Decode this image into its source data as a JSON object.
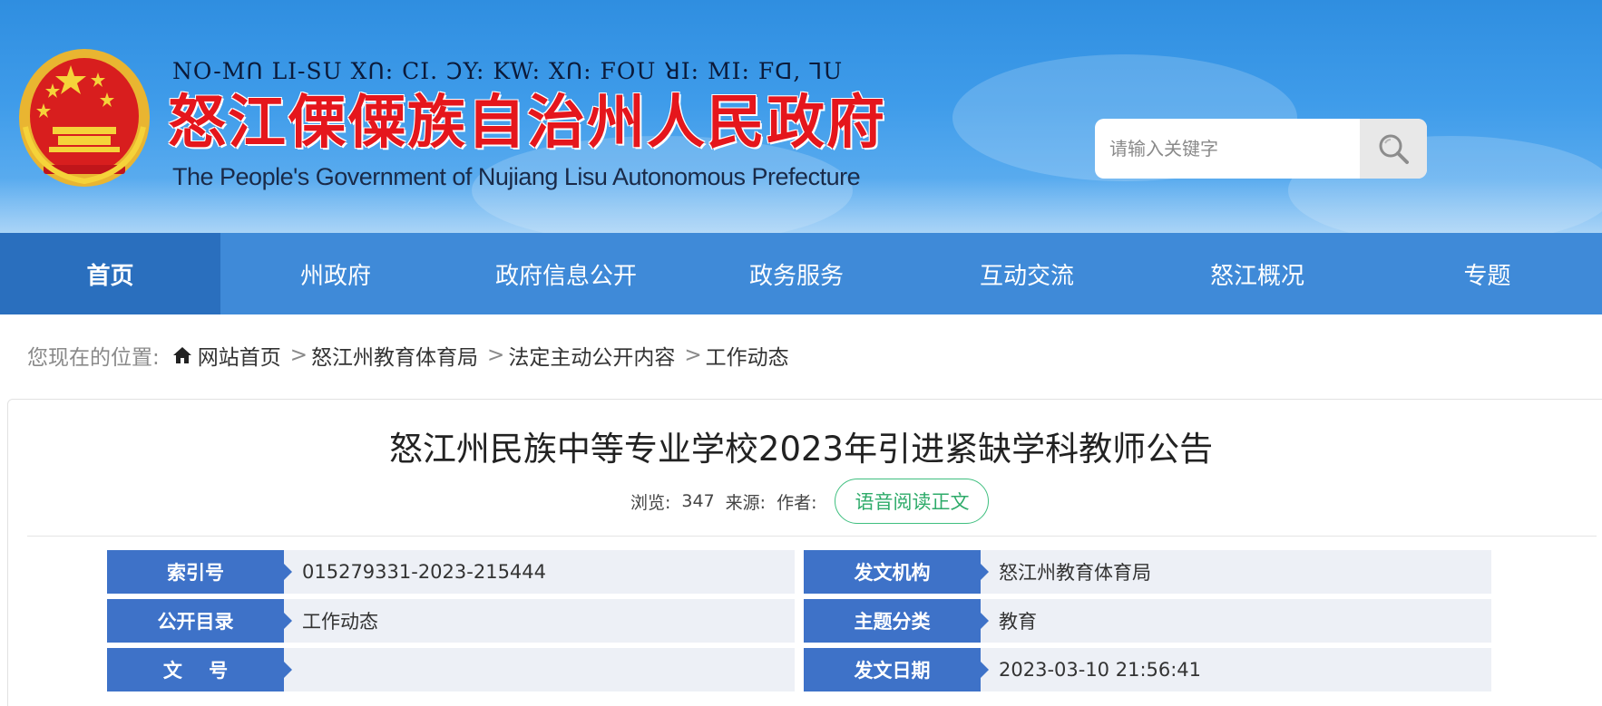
{
  "header": {
    "title_lisu": "NO-Mꓵ LI-SU Xꓵ: CI. ꓛY: KW: Xꓵ: FOU ꓤI: MI: Fꓷ, ꓶU",
    "title_cn": "怒江傈僳族自治州人民政府",
    "title_en": "The People's Government of Nujiang Lisu Autonomous Prefecture",
    "search": {
      "placeholder": "请输入关键字"
    }
  },
  "nav": {
    "items": [
      {
        "label": "首页"
      },
      {
        "label": "州政府"
      },
      {
        "label": "政府信息公开"
      },
      {
        "label": "政务服务"
      },
      {
        "label": "互动交流"
      },
      {
        "label": "怒江概况"
      },
      {
        "label": "专题"
      }
    ]
  },
  "breadcrumb": {
    "prefix": "您现在的位置:",
    "items": [
      {
        "label": "网站首页"
      },
      {
        "label": "怒江州教育体育局"
      },
      {
        "label": "法定主动公开内容"
      },
      {
        "label": "工作动态"
      }
    ],
    "separator": ">"
  },
  "article": {
    "title": "怒江州民族中等专业学校2023年引进紧缺学科教师公告",
    "views_label": "浏览:",
    "views": "347",
    "source_label": "来源:",
    "author_label": "作者:",
    "voice_button": "语音阅读正文"
  },
  "info": {
    "rows": [
      {
        "label1": "索引号",
        "value1": "015279331-2023-215444",
        "label2": "发文机构",
        "value2": "怒江州教育体育局"
      },
      {
        "label1": "公开目录",
        "value1": "工作动态",
        "label2": "主题分类",
        "value2": "教育"
      },
      {
        "label1": "文    号",
        "value1": "",
        "label2": "发文日期",
        "value2": "2023-03-10 21:56:41"
      }
    ]
  },
  "colors": {
    "nav_bg": "#3f8ad8",
    "nav_active": "#2a6fbe",
    "title_red": "#e5161c",
    "label_blue": "#3e72c8",
    "voice_green": "#2eab6a"
  }
}
